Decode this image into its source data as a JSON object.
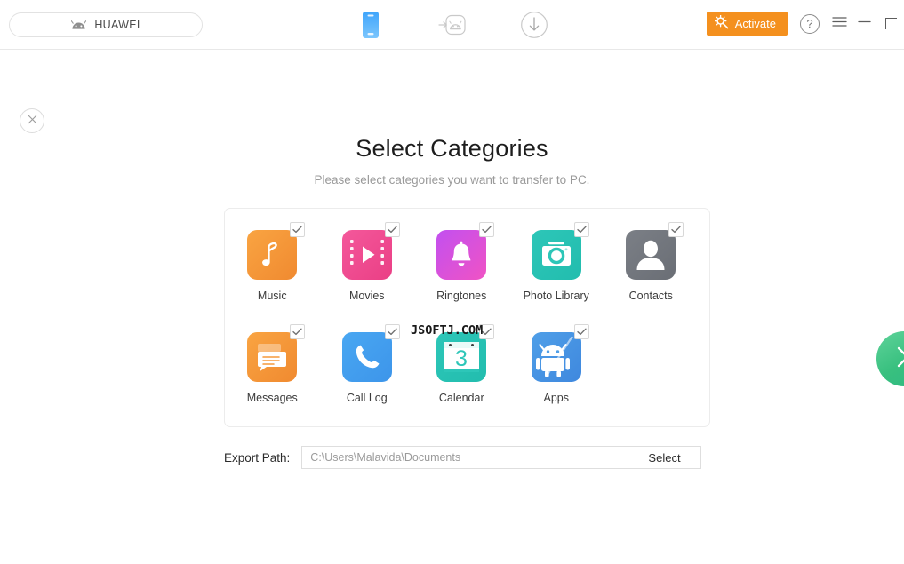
{
  "header": {
    "device_label": "HUAWEI",
    "device_icon": "android-head-icon",
    "nav_icons": [
      {
        "name": "phone-device-icon",
        "active": true
      },
      {
        "name": "android-transfer-icon",
        "active": false
      },
      {
        "name": "download-circle-icon",
        "active": false
      }
    ],
    "activate_label": "Activate",
    "activate_icon": "key-sparkle-icon",
    "activate_color": "#f4901e",
    "help_label": "?",
    "menu_icon": "hamburger-menu-icon",
    "minimize_icon": "minimize-icon",
    "maximize_icon": "maximize-icon"
  },
  "main": {
    "close_icon": "close-x-icon",
    "title": "Select Categories",
    "subtitle": "Please select categories you want to transfer to PC.",
    "watermark": "JSOFTJ.COM",
    "categories": [
      {
        "label": "Music",
        "icon": "music-note-icon",
        "checked": true,
        "color": "#f9a442"
      },
      {
        "label": "Movies",
        "icon": "film-play-icon",
        "checked": true,
        "color": "#f4589b"
      },
      {
        "label": "Ringtones",
        "icon": "bell-icon",
        "checked": true,
        "color": "#c250f0"
      },
      {
        "label": "Photo Library",
        "icon": "camera-icon",
        "checked": true,
        "color": "#2dc6b8"
      },
      {
        "label": "Contacts",
        "icon": "person-silhouette-icon",
        "checked": true,
        "color": "#7b7f86"
      },
      {
        "label": "Messages",
        "icon": "message-bubble-icon",
        "checked": true,
        "color": "#f9a442"
      },
      {
        "label": "Call Log",
        "icon": "phone-handset-icon",
        "checked": true,
        "color": "#49a7f2"
      },
      {
        "label": "Calendar",
        "icon": "calendar-icon",
        "checked": true,
        "color": "#2dc6b8",
        "day": "3"
      },
      {
        "label": "Apps",
        "icon": "android-robot-icon",
        "checked": true,
        "color": "#4f9fe8"
      }
    ],
    "export": {
      "label": "Export Path:",
      "value": "C:\\Users\\Malavida\\Documents",
      "placeholder": "C:\\Users\\Malavida\\Documents",
      "select_label": "Select"
    },
    "next_icon": "chevron-right-icon",
    "next_color": "#38c07f"
  }
}
